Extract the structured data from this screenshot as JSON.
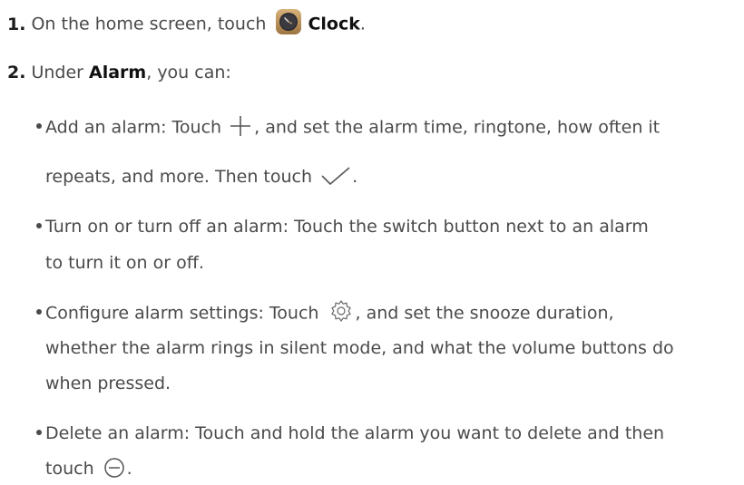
{
  "steps": [
    {
      "number": "1.",
      "text_before": "On the home screen, touch",
      "app_icon": "clock-app-icon",
      "app_name": "Clock",
      "text_after": "."
    },
    {
      "number": "2.",
      "text_before": "Under",
      "section": "Alarm",
      "text_after": ", you can:"
    }
  ],
  "bullets": [
    {
      "line1_before": "Add an alarm: Touch",
      "line1_icon": "plus-icon",
      "line1_after": ", and set the alarm time, ringtone, how often it",
      "line2_before": "repeats, and more. Then touch",
      "line2_icon": "checkmark-icon",
      "line2_after": "."
    },
    {
      "line1": "Turn on or turn off an alarm: Touch the switch button next to an alarm",
      "line2": "to turn it on or off."
    },
    {
      "line1_before": "Configure alarm settings: Touch",
      "line1_icon": "gear-icon",
      "line1_after": ", and set the snooze duration,",
      "line2": "whether the alarm rings in silent mode, and what the volume buttons do",
      "line3": "when pressed."
    },
    {
      "line1": "Delete an alarm: Touch and hold the alarm you want to delete and then",
      "line2_before": "touch",
      "line2_icon": "minus-circle-icon",
      "line2_after": "."
    }
  ]
}
